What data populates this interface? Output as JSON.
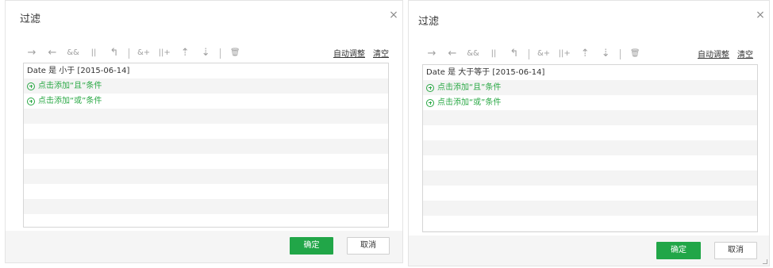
{
  "colors": {
    "accent_green": "#21a648",
    "add_link_green": "#2aa845",
    "stripe": "#f4f4f4",
    "footer_bg": "#f5f5f5"
  },
  "icons": [
    "arrow-right-icon",
    "arrow-left-icon",
    "and-icon",
    "or-icon",
    "return-icon",
    "add-and-icon",
    "add-or-icon",
    "move-up-icon",
    "move-down-icon",
    "delete-icon"
  ],
  "toolbar": {
    "glyphs": {
      "arrow_right": "→",
      "arrow_left": "←",
      "and": "&&",
      "or": "||",
      "return": "↰",
      "add_and": "&+",
      "add_or": "||+",
      "move_up": "⇡",
      "move_down": "⇣",
      "delete": "🗑"
    },
    "auto_adjust_label": "自动调整",
    "clear_label": "清空"
  },
  "dialogs": [
    {
      "title": "过滤",
      "close_glyph": "×",
      "condition": "Date 是 小于 [2015-06-14]",
      "add_and_label": "点击添加“且”条件",
      "add_or_label": "点击添加“或”条件",
      "ok_label": "确定",
      "cancel_label": "取消"
    },
    {
      "title": "过滤",
      "close_glyph": "×",
      "condition": "Date 是 大于等于 [2015-06-14]",
      "add_and_label": "点击添加“且”条件",
      "add_or_label": "点击添加“或”条件",
      "ok_label": "确定",
      "cancel_label": "取消"
    }
  ]
}
